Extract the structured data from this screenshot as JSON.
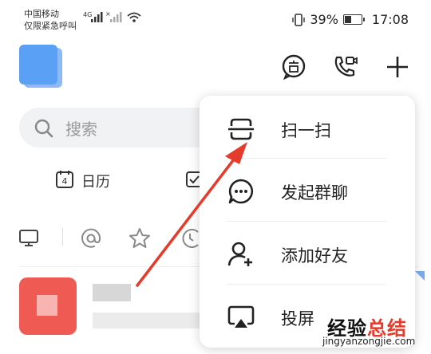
{
  "status_bar": {
    "carrier_line1": "中国移动",
    "carrier_line2": "仅限紧急呼叫",
    "network": "4G",
    "battery_percent": "39%",
    "battery_level": 0.39,
    "time": "17:08"
  },
  "search": {
    "placeholder": "搜索"
  },
  "shortcuts": {
    "calendar_date": "4",
    "calendar_label": "日历"
  },
  "popup_menu": {
    "items": [
      {
        "label": "扫一扫",
        "icon": "scan-icon"
      },
      {
        "label": "发起群聊",
        "icon": "group-chat-icon"
      },
      {
        "label": "添加好友",
        "icon": "add-friend-icon"
      },
      {
        "label": "投屏",
        "icon": "screen-cast-icon"
      }
    ]
  },
  "watermark": {
    "text_main": "经验",
    "text_accent": "总结",
    "url": "jingyanzongjie.com"
  },
  "colors": {
    "accent_red": "#e43b2c",
    "avatar_blue": "#5aa0f5",
    "chat_avatar_red": "#ef5a52"
  }
}
